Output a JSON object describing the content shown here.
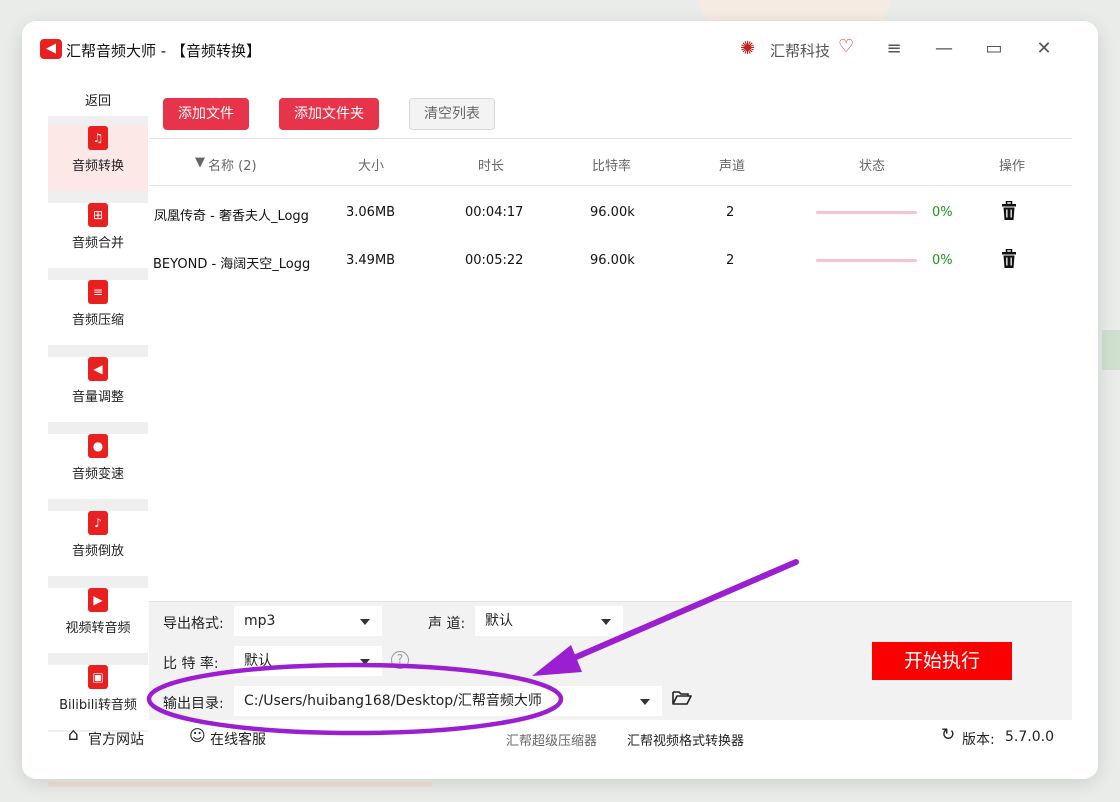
{
  "window": {
    "app_logo_glyph": "◀",
    "app_title": "汇帮音频大师  - 【音频转换】",
    "brand_icon": "✺",
    "brand_name": "汇帮科技",
    "brand_heart_glyph": "♡",
    "menu_glyph": "≡",
    "minimize_glyph": "—",
    "maximize_glyph": "▭",
    "close_glyph": "✕"
  },
  "sidebar": {
    "back_label": "返回",
    "items": [
      {
        "label": "音频转换",
        "icon": "music-convert-icon",
        "glyph": "♫",
        "active": true
      },
      {
        "label": "音频合并",
        "icon": "audio-merge-icon",
        "glyph": "⊞",
        "active": false
      },
      {
        "label": "音频压缩",
        "icon": "audio-compress-icon",
        "glyph": "≡",
        "active": false
      },
      {
        "label": "音量调整",
        "icon": "volume-icon",
        "glyph": "◀",
        "active": false
      },
      {
        "label": "音频变速",
        "icon": "microphone-icon",
        "glyph": "●",
        "active": false
      },
      {
        "label": "音频倒放",
        "icon": "music-note-icon",
        "glyph": "♪",
        "active": false
      },
      {
        "label": "视频转音频",
        "icon": "film-icon",
        "glyph": "▶",
        "active": false
      },
      {
        "label": "Bilibili转音频",
        "icon": "bilibili-tv-icon",
        "glyph": "▣",
        "active": false
      }
    ]
  },
  "toolbar": {
    "add_file": "添加文件",
    "add_folder": "添加文件夹",
    "clear_list": "清空列表"
  },
  "table": {
    "sort_glyph": "▼",
    "headers": [
      "名称 (2)",
      "大小",
      "时长",
      "比特率",
      "声道",
      "状态",
      "操作"
    ],
    "rows": [
      {
        "name": "凤凰传奇 - 奢香夫人_Logg",
        "size": "3.06MB",
        "duration": "00:04:17",
        "bitrate": "96.00k",
        "channels": "2",
        "progress": 0,
        "status": "0%"
      },
      {
        "name": "BEYOND - 海阔天空_Logg",
        "size": "3.49MB",
        "duration": "00:05:22",
        "bitrate": "96.00k",
        "channels": "2",
        "progress": 0,
        "status": "0%"
      }
    ]
  },
  "settings": {
    "format_label": "导出格式:",
    "format_value": "mp3",
    "channel_label": "声 道:",
    "channel_value": "默认",
    "bitrate_label": "比 特 率:",
    "bitrate_value": "默认",
    "help_glyph": "?",
    "output_label": "输出目录:",
    "output_value": "C:/Users/huibang168/Desktop/汇帮音频大师",
    "start_button": "开始执行"
  },
  "footer": {
    "home_icon": "⌂",
    "website": "官方网站",
    "support_icon": "☺",
    "support": "在线客服",
    "link1": "汇帮超级压缩器",
    "link2": "汇帮视频格式转换器",
    "refresh_icon": "↻",
    "version_label": "版本:",
    "version": "5.7.0.0"
  },
  "colors": {
    "accent_red": "#e8344a",
    "start_red": "#fb0000",
    "annotation_purple": "#9b1fd1",
    "status_green": "#1a9a1a"
  }
}
